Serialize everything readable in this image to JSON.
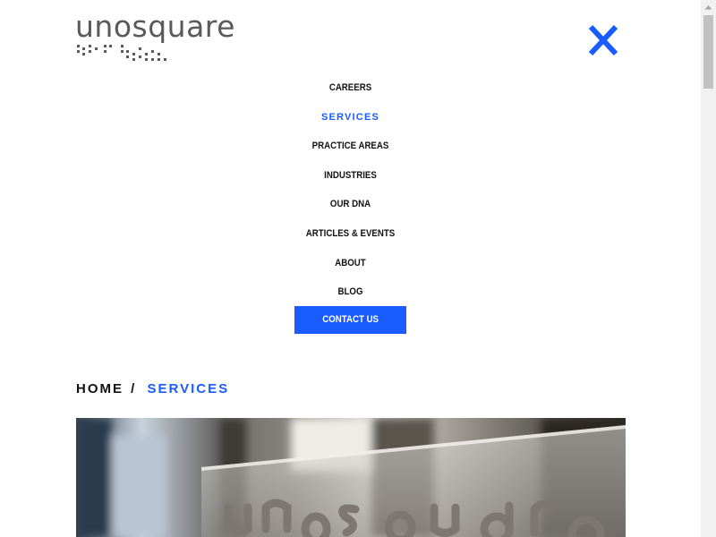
{
  "logo": {
    "text": "unosquare"
  },
  "header": {
    "close_icon": "close-icon"
  },
  "menu": {
    "items": [
      {
        "label": "CAREERS"
      },
      {
        "label": "SERVICES"
      },
      {
        "label": "PRACTICE AREAS"
      },
      {
        "label": "INDUSTRIES"
      },
      {
        "label": "OUR DNA"
      },
      {
        "label": "ARTICLES & EVENTS"
      },
      {
        "label": "ABOUT"
      },
      {
        "label": "BLOG"
      }
    ],
    "active_index": 1,
    "contact_label": "CONTACT US"
  },
  "breadcrumb": {
    "home": "HOME",
    "separator": "/",
    "current": "SERVICES"
  },
  "colors": {
    "accent": "#1a5cff",
    "text": "#111111",
    "logo": "#5a5a5a"
  }
}
